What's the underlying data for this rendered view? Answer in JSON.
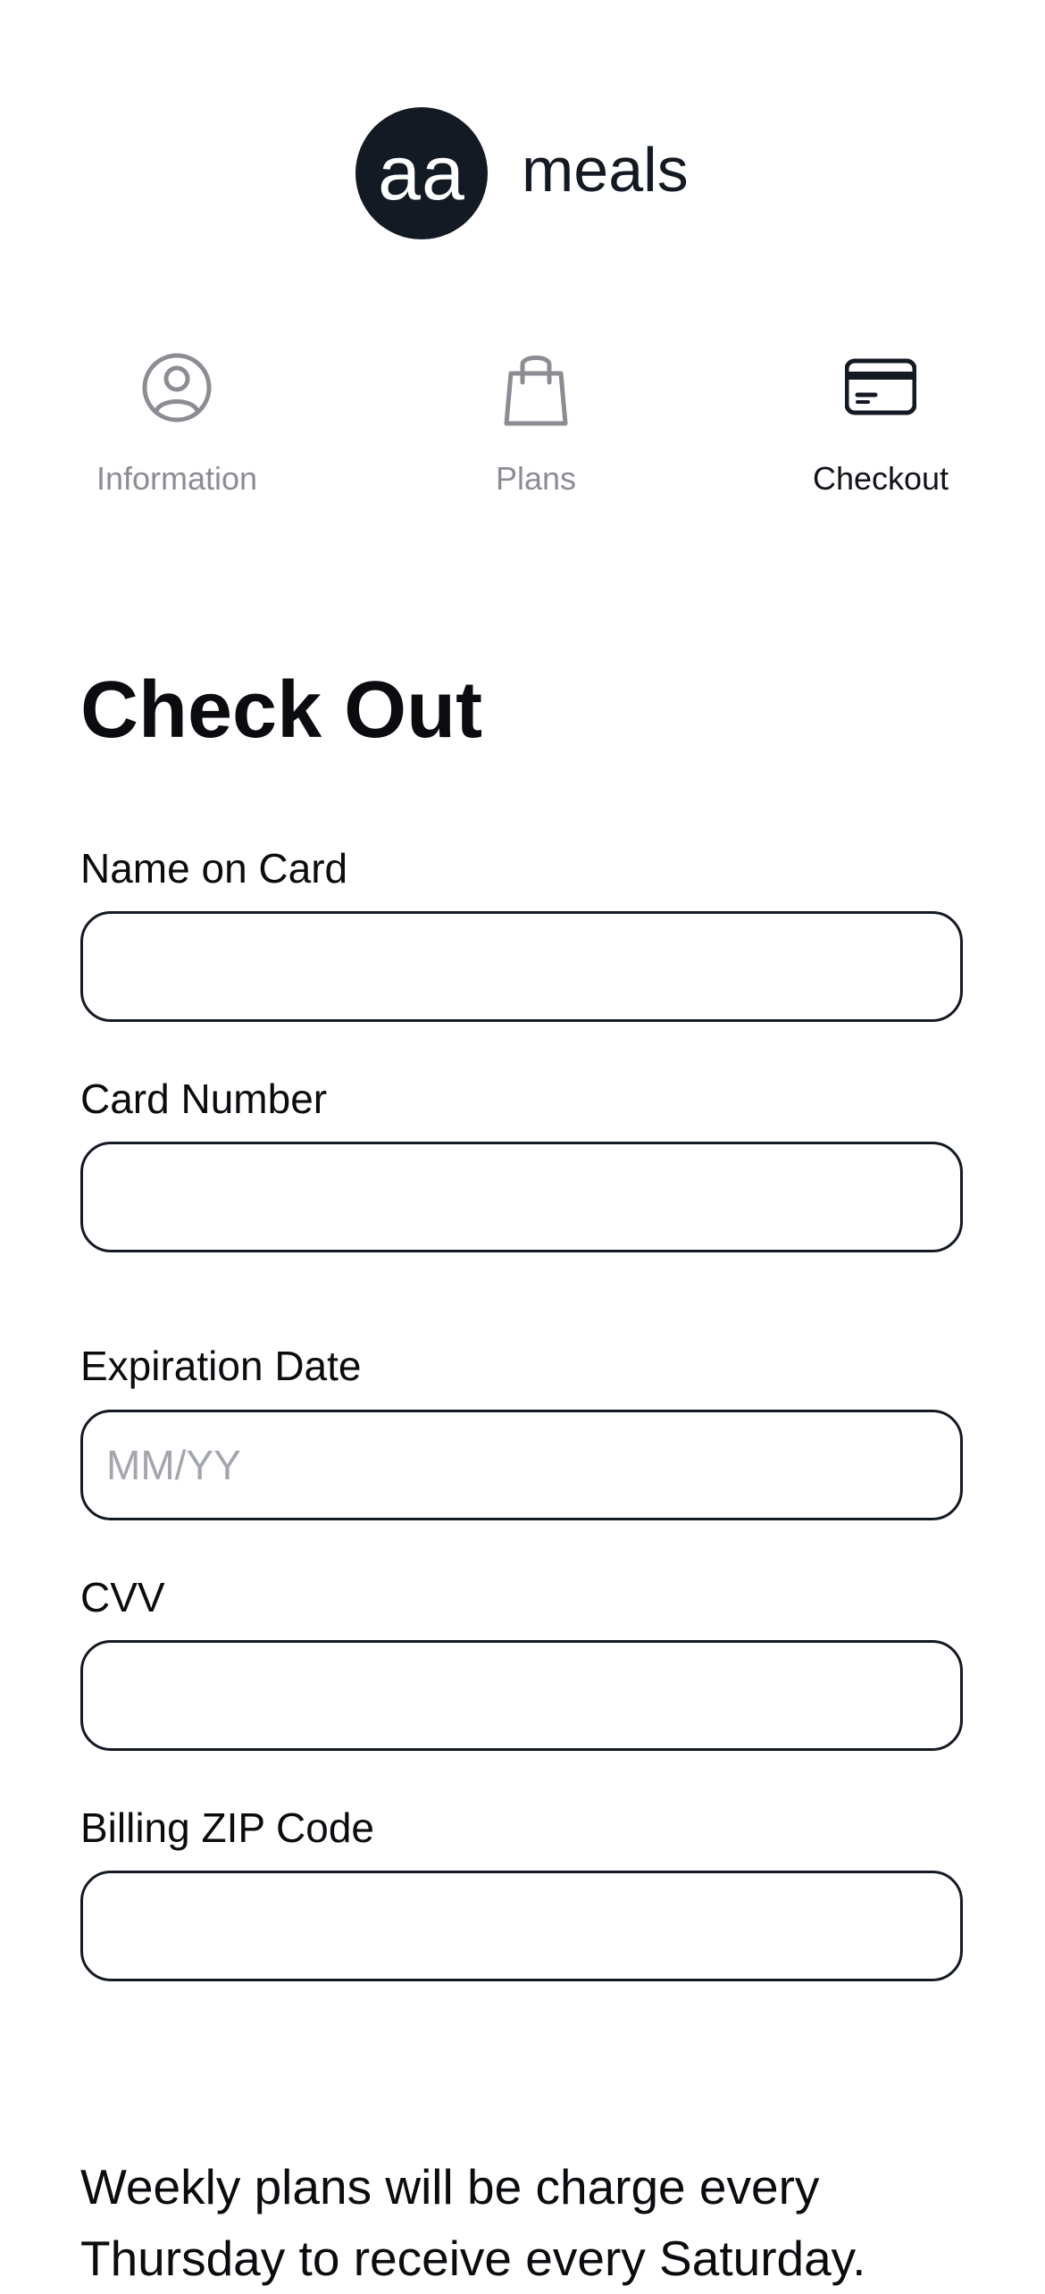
{
  "brand": {
    "mark": "aa",
    "word": "meals"
  },
  "steps": [
    {
      "label": "Information",
      "icon": "user-circle-icon",
      "active": false
    },
    {
      "label": "Plans",
      "icon": "shopping-bag-icon",
      "active": false
    },
    {
      "label": "Checkout",
      "icon": "credit-card-icon",
      "active": true
    }
  ],
  "page": {
    "title": "Check Out"
  },
  "form": {
    "name_on_card": {
      "label": "Name on Card",
      "value": "",
      "placeholder": ""
    },
    "card_number": {
      "label": "Card Number",
      "value": "",
      "placeholder": ""
    },
    "expiration_date": {
      "label": "Expiration Date",
      "value": "",
      "placeholder": "MM/YY"
    },
    "cvv": {
      "label": "CVV",
      "value": "",
      "placeholder": ""
    },
    "billing_zip": {
      "label": "Billing ZIP Code",
      "value": "",
      "placeholder": ""
    }
  },
  "note": {
    "text": "Weekly plans will be charge every Thursday to receive every Saturday."
  },
  "colors": {
    "brand_dark": "#141a24",
    "inactive_text": "#8b8d93",
    "placeholder": "#a3a6ad"
  }
}
